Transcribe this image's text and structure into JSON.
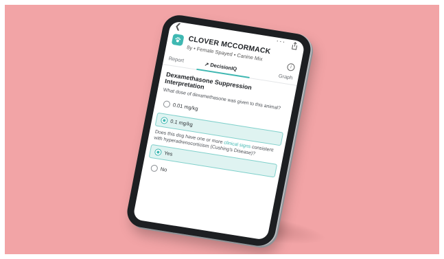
{
  "app": {
    "patient_name": "CLOVER MCCORMACK",
    "patient_details": "8y • Female Spayed • Canine Mix"
  },
  "tabs": [
    {
      "label": "Report"
    },
    {
      "label": "DecisionIQ"
    },
    {
      "label": "Graph"
    }
  ],
  "main": {
    "section_title": "Dexamethasone Suppression Interpretation",
    "question1": "What dose of dexamethasone was given to this animal?",
    "q1_options": [
      {
        "label": "0.01 mg/kg",
        "selected": false
      },
      {
        "label": "0.1 mg/kg",
        "selected": true
      }
    ],
    "question2_prefix": "Does this dog have one or more ",
    "question2_link": "clinical signs",
    "question2_suffix": " consistent with hyperadrenocorticism (Cushing's Disease)?",
    "q2_options": [
      {
        "label": "Yes",
        "selected": true
      },
      {
        "label": "No",
        "selected": false
      }
    ]
  },
  "colors": {
    "accent": "#3fb8b2",
    "background": "#f2a4a6",
    "selected_bg": "#dff3f1"
  },
  "icons": [
    "back-icon",
    "more-icon",
    "share-icon",
    "paw-icon",
    "info-icon",
    "decision-arrows-icon"
  ]
}
